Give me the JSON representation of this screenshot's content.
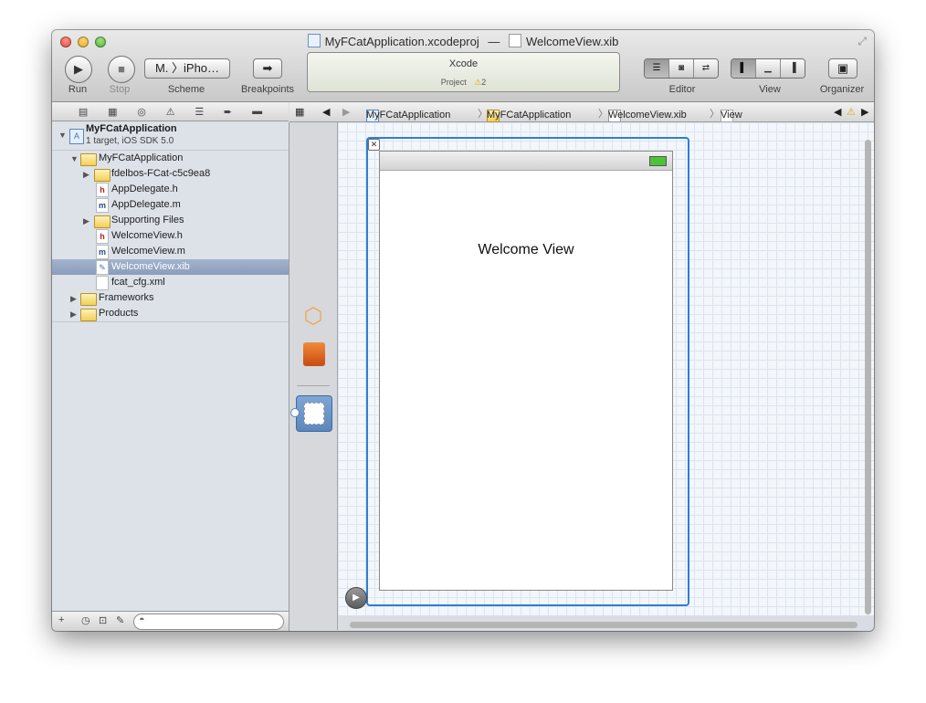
{
  "window": {
    "title_project": "MyFCatApplication.xcodeproj",
    "title_sep": "—",
    "title_file": "WelcomeView.xib"
  },
  "toolbar": {
    "run_label": "Run",
    "stop_label": "Stop",
    "scheme_label": "Scheme",
    "scheme_value": "M. 〉iPho…",
    "breakpoints_label": "Breakpoints",
    "editor_label": "Editor",
    "view_label": "View",
    "organizer_label": "Organizer"
  },
  "activity": {
    "app_name": "Xcode",
    "project_label": "Project",
    "warning_count": "2"
  },
  "navigator": {
    "project_name": "MyFCatApplication",
    "project_subtitle": "1 target, iOS SDK 5.0",
    "items": [
      {
        "label": "MyFCatApplication",
        "kind": "folder"
      },
      {
        "label": "fdelbos-FCat-c5c9ea8",
        "kind": "folder"
      },
      {
        "label": "AppDelegate.h",
        "kind": "h"
      },
      {
        "label": "AppDelegate.m",
        "kind": "m"
      },
      {
        "label": "Supporting Files",
        "kind": "folder"
      },
      {
        "label": "WelcomeView.h",
        "kind": "h"
      },
      {
        "label": "WelcomeView.m",
        "kind": "m"
      },
      {
        "label": "WelcomeView.xib",
        "kind": "xib"
      },
      {
        "label": "fcat_cfg.xml",
        "kind": "xml"
      },
      {
        "label": "Frameworks",
        "kind": "folder"
      },
      {
        "label": "Products",
        "kind": "folder"
      }
    ],
    "footer_add": "+"
  },
  "jumpbar": {
    "crumbs": [
      "MyFCatApplication",
      "MyFCatApplication",
      "WelcomeView.xib",
      "View"
    ],
    "separator": "〉"
  },
  "canvas": {
    "welcome_text": "Welcome View"
  },
  "colors": {
    "selection": "#8a9dbb",
    "view_frame": "#2f7fd0",
    "canvas_bg": "#f3f6fa"
  }
}
